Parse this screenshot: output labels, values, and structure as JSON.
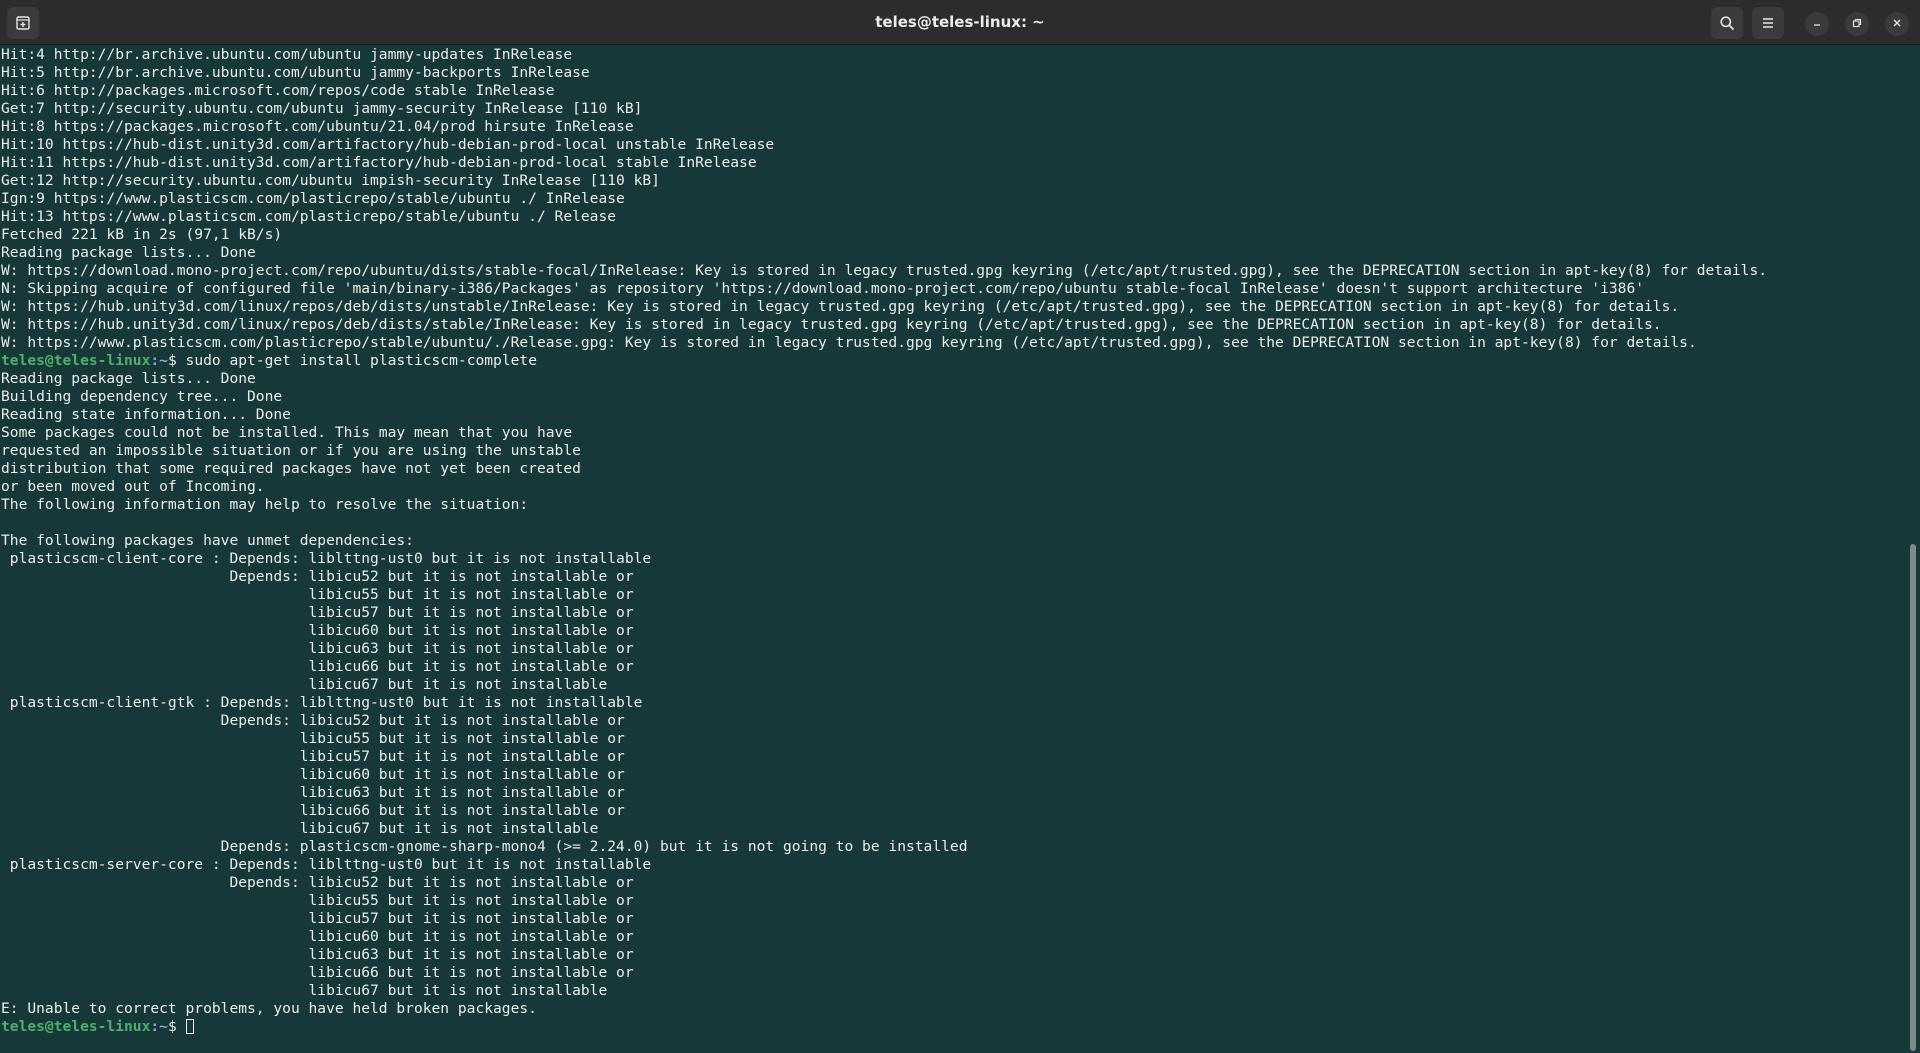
{
  "window": {
    "title": "teles@teles-linux: ~",
    "new_tab_icon": "new-tab-icon",
    "search_icon": "search-icon",
    "menu_icon": "hamburger-menu-icon",
    "minimize_icon": "minimize-icon",
    "maximize_icon": "restore-icon",
    "close_icon": "close-icon"
  },
  "terminal": {
    "colors": {
      "background": "#173838",
      "foreground": "#ececec",
      "prompt_user": "#4fb06a",
      "prompt_path": "#8aa8d8"
    },
    "lines": [
      {
        "text": "Hit:4 http://br.archive.ubuntu.com/ubuntu jammy-updates InRelease"
      },
      {
        "text": "Hit:5 http://br.archive.ubuntu.com/ubuntu jammy-backports InRelease"
      },
      {
        "text": "Hit:6 http://packages.microsoft.com/repos/code stable InRelease"
      },
      {
        "text": "Get:7 http://security.ubuntu.com/ubuntu jammy-security InRelease [110 kB]"
      },
      {
        "text": "Hit:8 https://packages.microsoft.com/ubuntu/21.04/prod hirsute InRelease"
      },
      {
        "text": "Hit:10 https://hub-dist.unity3d.com/artifactory/hub-debian-prod-local unstable InRelease"
      },
      {
        "text": "Hit:11 https://hub-dist.unity3d.com/artifactory/hub-debian-prod-local stable InRelease"
      },
      {
        "text": "Get:12 http://security.ubuntu.com/ubuntu impish-security InRelease [110 kB]"
      },
      {
        "text": "Ign:9 https://www.plasticscm.com/plasticrepo/stable/ubuntu ./ InRelease"
      },
      {
        "text": "Hit:13 https://www.plasticscm.com/plasticrepo/stable/ubuntu ./ Release"
      },
      {
        "text": "Fetched 221 kB in 2s (97,1 kB/s)"
      },
      {
        "text": "Reading package lists... Done"
      },
      {
        "text": "W: https://download.mono-project.com/repo/ubuntu/dists/stable-focal/InRelease: Key is stored in legacy trusted.gpg keyring (/etc/apt/trusted.gpg), see the DEPRECATION section in apt-key(8) for details."
      },
      {
        "text": "N: Skipping acquire of configured file 'main/binary-i386/Packages' as repository 'https://download.mono-project.com/repo/ubuntu stable-focal InRelease' doesn't support architecture 'i386'"
      },
      {
        "text": "W: https://hub.unity3d.com/linux/repos/deb/dists/unstable/InRelease: Key is stored in legacy trusted.gpg keyring (/etc/apt/trusted.gpg), see the DEPRECATION section in apt-key(8) for details."
      },
      {
        "text": "W: https://hub.unity3d.com/linux/repos/deb/dists/stable/InRelease: Key is stored in legacy trusted.gpg keyring (/etc/apt/trusted.gpg), see the DEPRECATION section in apt-key(8) for details."
      },
      {
        "text": "W: https://www.plasticscm.com/plasticrepo/stable/ubuntu/./Release.gpg: Key is stored in legacy trusted.gpg keyring (/etc/apt/trusted.gpg), see the DEPRECATION section in apt-key(8) for details."
      },
      {
        "user": "teles@teles-linux",
        "path": ":~",
        "sym": "$ ",
        "text": "sudo apt-get install plasticscm-complete"
      },
      {
        "text": "Reading package lists... Done"
      },
      {
        "text": "Building dependency tree... Done"
      },
      {
        "text": "Reading state information... Done"
      },
      {
        "text": "Some packages could not be installed. This may mean that you have"
      },
      {
        "text": "requested an impossible situation or if you are using the unstable"
      },
      {
        "text": "distribution that some required packages have not yet been created"
      },
      {
        "text": "or been moved out of Incoming."
      },
      {
        "text": "The following information may help to resolve the situation:"
      },
      {
        "text": ""
      },
      {
        "text": "The following packages have unmet dependencies:"
      },
      {
        "text": " plasticscm-client-core : Depends: liblttng-ust0 but it is not installable"
      },
      {
        "text": "                          Depends: libicu52 but it is not installable or"
      },
      {
        "text": "                                   libicu55 but it is not installable or"
      },
      {
        "text": "                                   libicu57 but it is not installable or"
      },
      {
        "text": "                                   libicu60 but it is not installable or"
      },
      {
        "text": "                                   libicu63 but it is not installable or"
      },
      {
        "text": "                                   libicu66 but it is not installable or"
      },
      {
        "text": "                                   libicu67 but it is not installable"
      },
      {
        "text": " plasticscm-client-gtk : Depends: liblttng-ust0 but it is not installable"
      },
      {
        "text": "                         Depends: libicu52 but it is not installable or"
      },
      {
        "text": "                                  libicu55 but it is not installable or"
      },
      {
        "text": "                                  libicu57 but it is not installable or"
      },
      {
        "text": "                                  libicu60 but it is not installable or"
      },
      {
        "text": "                                  libicu63 but it is not installable or"
      },
      {
        "text": "                                  libicu66 but it is not installable or"
      },
      {
        "text": "                                  libicu67 but it is not installable"
      },
      {
        "text": "                         Depends: plasticscm-gnome-sharp-mono4 (>= 2.24.0) but it is not going to be installed"
      },
      {
        "text": " plasticscm-server-core : Depends: liblttng-ust0 but it is not installable"
      },
      {
        "text": "                          Depends: libicu52 but it is not installable or"
      },
      {
        "text": "                                   libicu55 but it is not installable or"
      },
      {
        "text": "                                   libicu57 but it is not installable or"
      },
      {
        "text": "                                   libicu60 but it is not installable or"
      },
      {
        "text": "                                   libicu63 but it is not installable or"
      },
      {
        "text": "                                   libicu66 but it is not installable or"
      },
      {
        "text": "                                   libicu67 but it is not installable"
      },
      {
        "text": "E: Unable to correct problems, you have held broken packages."
      },
      {
        "user": "teles@teles-linux",
        "path": ":~",
        "sym": "$ ",
        "text": "",
        "cursor": true
      }
    ]
  }
}
